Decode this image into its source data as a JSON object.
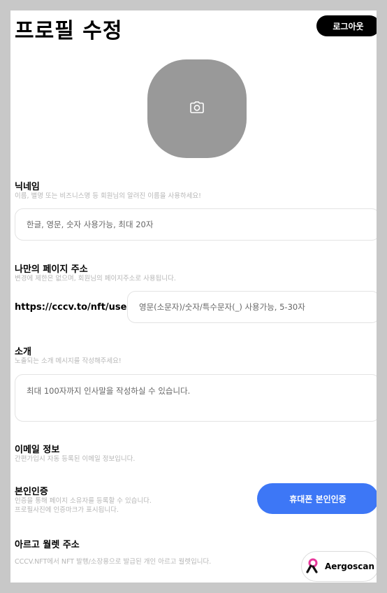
{
  "header": {
    "title": "프로필 수정",
    "logout_label": "로그아웃"
  },
  "avatar": {
    "icon": "camera-icon"
  },
  "nickname": {
    "label": "닉네임",
    "help": "이름, 별명 또는 비즈니스명 등 회원님의 알려진 이름을 사용하세요!",
    "placeholder": "한글, 영문, 숫자 사용가능, 최대 20자"
  },
  "page_address": {
    "label": "나만의 페이지 주소",
    "help": "변경에 제한은 없으며, 회원님의 페이지주소로 사용됩니다.",
    "prefix": "https://cccv.to/nft/user/",
    "placeholder": "영문(소문자)/숫자/특수문자(_) 사용가능, 5-30자"
  },
  "intro": {
    "label": "소개",
    "help": "노출되는 소개 메시지를 작성해주세요!",
    "placeholder": "최대 100자까지 인사말을 작성하실 수 있습니다."
  },
  "email": {
    "label": "이메일 정보",
    "help": "간편가입시 자동 등록된 이메일 정보입니다."
  },
  "verification": {
    "label": "본인인증",
    "help_line1": "인증을 통해 페이지 소유자를 등록할 수 있습니다.",
    "help_line2": "프로필사진에 인증마크가 표시됩니다.",
    "button_label": "휴대폰 본인인증"
  },
  "wallet": {
    "label": "아르고 월렛 주소",
    "help": "CCCV.NFT에서 NFT 발행/소장용으로 발급된 개인 아르고 월렛입니다.",
    "aergoscan_label": "Aergoscan",
    "aergoscan_icon": "aergo-logo-icon"
  },
  "colors": {
    "primary_button": "#3d77f6",
    "avatar_bg": "#999999",
    "background": "#c8c8c8"
  }
}
